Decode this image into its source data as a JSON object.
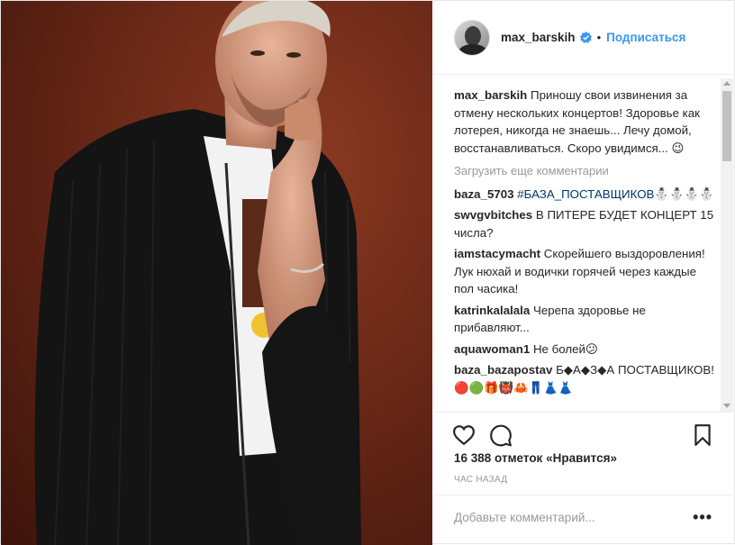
{
  "post": {
    "username": "max_barskih",
    "follow_label": "Подписаться",
    "dot": "•",
    "more_icon": "•••"
  },
  "caption": {
    "username": "max_barskih",
    "text": "Приношу свои извинения за отмену нескольких концертов! Здоровье как лотерея, никогда не знаешь... Лечу домой, восстанавливаться. Скоро увидимся... 😉"
  },
  "load_more": "Загрузить еще комментарии",
  "comments": [
    {
      "username": "baza_5703",
      "text": "#БАЗА_ПОСТАВЩИКОВ⛄⛄⛄⛄"
    },
    {
      "username": "swvgvbitches",
      "text": "В ПИТЕРЕ БУДЕТ КОНЦЕРТ 15 числа?"
    },
    {
      "username": "iamstacymacht",
      "text": "Скорейшего выздоровления! Лук нюхай и водички горячей через каждые пол часика!"
    },
    {
      "username": "katrinkalalala",
      "text": "Черепа здоровье не прибавляют..."
    },
    {
      "username": "aquawoman1",
      "text": "Не болей😕"
    },
    {
      "username": "baza_bazapostav",
      "text": "Б◆А◆З◆А ПОСТАВЩИКОВ! 🔴🟢🎁👹🦀👖👗👗"
    }
  ],
  "likes": "16 388 отметок «Нравится»",
  "time": "ЧАС НАЗАД",
  "add_comment_placeholder": "Добавьте комментарий...",
  "colors": {
    "link": "#3897f0",
    "verified": "#3897f0",
    "text": "#262626",
    "muted": "#999999"
  },
  "icons": [
    "heart-icon",
    "comment-icon",
    "bookmark-icon",
    "verified-icon",
    "more-icon"
  ]
}
